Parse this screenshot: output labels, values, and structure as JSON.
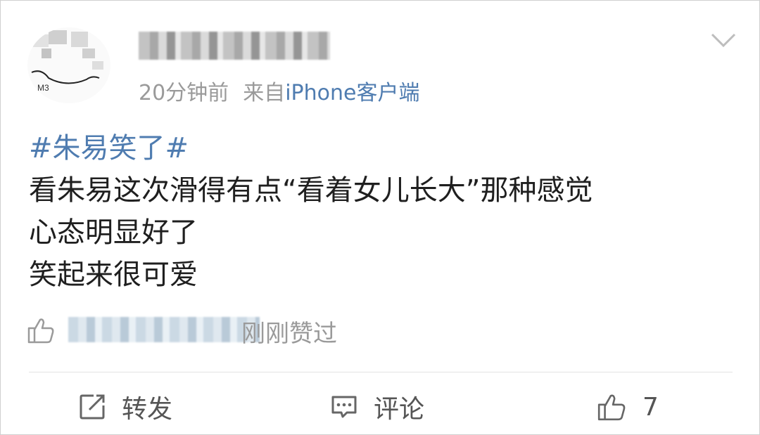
{
  "post": {
    "time": "20分钟前",
    "source_prefix": "来自",
    "source": "iPhone客户端",
    "topic": "#朱易笑了#",
    "lines": [
      "看朱易这次滑得有点“看着女儿长大”那种感觉",
      "心态明显好了",
      "笑起来很可爱"
    ]
  },
  "likes": {
    "text": "刚刚赞过"
  },
  "actions": {
    "repost_label": "转发",
    "comment_label": "评论",
    "like_count": "7"
  },
  "icons": [
    "chevron-down-icon",
    "thumbs-up-icon",
    "repost-icon",
    "comment-icon"
  ]
}
